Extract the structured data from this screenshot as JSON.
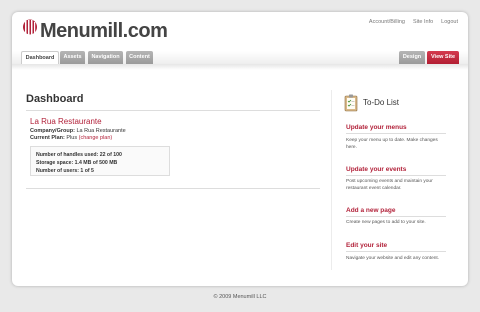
{
  "brand": {
    "logo_text": "Menumill.com"
  },
  "top_links": [
    "Account/Billing",
    "Site Info",
    "Logout"
  ],
  "tabs": {
    "dashboard": "Dashboard",
    "assets": "Assets",
    "navigation": "Navigation",
    "content": "Content",
    "design": "Design",
    "view_site": "View Site"
  },
  "main": {
    "title": "Dashboard",
    "restaurant_name": "La Rua Restaurante",
    "company_label": "Company/Group:",
    "company_value": "La Rua Restaurante",
    "plan_label": "Current Plan:",
    "plan_value": "Plus",
    "change_plan": "(change plan)",
    "stats": [
      "Number of handles used: 22 of 100",
      "Storage space: 1.4 MB of 500 MB",
      "Number of users: 1 of 5"
    ]
  },
  "sidebar": {
    "title": "To-Do List",
    "items": [
      {
        "heading": "Update your menus",
        "text": "Keep your menu up to date. Make changes here."
      },
      {
        "heading": "Update your events",
        "text": "Post upcoming events and maintain your restaurant event calendar."
      },
      {
        "heading": "Add a new page",
        "text": "Create new pages to add to your site."
      },
      {
        "heading": "Edit your site",
        "text": "Navigate your website and edit any content."
      }
    ]
  },
  "footer": "© 2009 Menumill LLC",
  "colors": {
    "accent": "#b2223a",
    "tab_gray": "#a8a8a8",
    "background": "#e9e9e9"
  },
  "icons": [
    "fork-logo-icon",
    "todo-clipboard-icon"
  ]
}
